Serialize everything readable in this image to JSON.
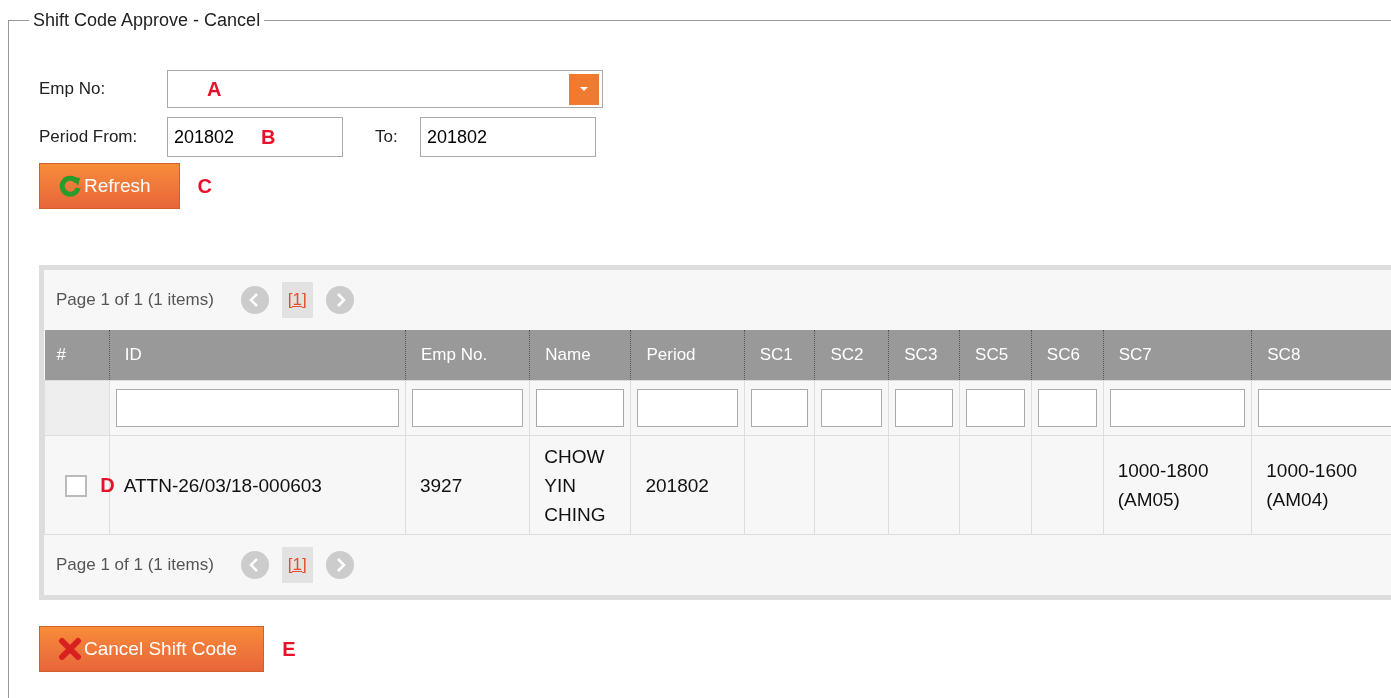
{
  "panel": {
    "title": "Shift Code Approve - Cancel"
  },
  "form": {
    "emp_no": {
      "label": "Emp No:",
      "annotation": "A"
    },
    "period_from": {
      "label": "Period From:",
      "value": "201802",
      "annotation": "B"
    },
    "period_to": {
      "label": "To:",
      "value": "201802"
    },
    "refresh_button": {
      "label": "Refresh",
      "annotation": "C"
    }
  },
  "grid": {
    "pager_top": {
      "summary": "Page 1 of 1 (1 items)",
      "pages": [
        {
          "label": "[1]",
          "selected": true
        }
      ]
    },
    "columns": [
      "#",
      "ID",
      "Emp No.",
      "Name",
      "Period",
      "SC1",
      "SC2",
      "SC3",
      "SC5",
      "SC6",
      "SC7",
      "SC8"
    ],
    "rows": [
      {
        "checked": false,
        "annotation": "D",
        "cells": [
          "",
          "ATTN-26/03/18-000603",
          "3927",
          "CHOW YIN CHING",
          "201802",
          "",
          "",
          "",
          "",
          "",
          "1000-1800 (AM05)",
          "1000-1600 (AM04)"
        ]
      }
    ],
    "pager_bottom": {
      "summary": "Page 1 of 1 (1 items)",
      "pages": [
        {
          "label": "[1]",
          "selected": true
        }
      ]
    }
  },
  "cancel_button": {
    "label": "Cancel Shift Code",
    "annotation": "E"
  }
}
